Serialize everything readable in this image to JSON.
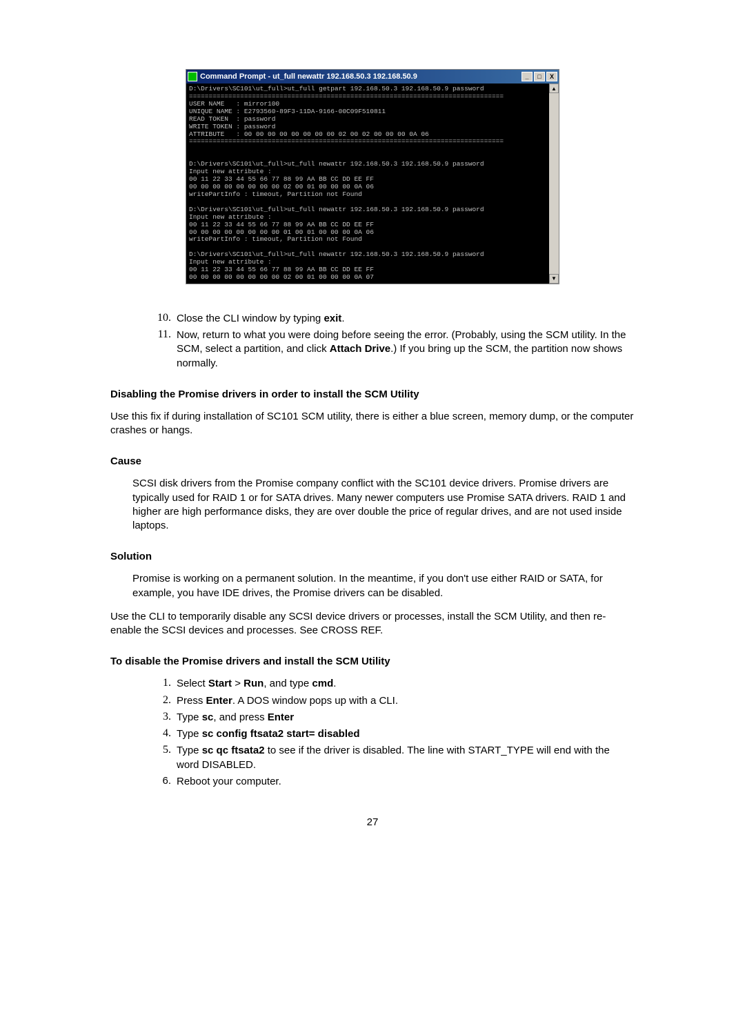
{
  "cmd": {
    "title": "Command Prompt - ut_full newattr 192.168.50.3 192.168.50.9",
    "text": "D:\\Drivers\\SC101\\ut_full>ut_full getpart 192.168.50.3 192.168.50.9 password\n================================================================================\nUSER NAME   : mirror100\nUNIQUE NAME : E2793560-89F3-11DA-9166-00C09F510811\nREAD TOKEN  : password\nWRITE TOKEN : password\nATTRIBUTE   : 00 00 00 00 00 00 00 00 02 00 02 00 00 00 0A 06\n================================================================================\n\n\nD:\\Drivers\\SC101\\ut_full>ut_full newattr 192.168.50.3 192.168.50.9 password\nInput new attribute :\n00 11 22 33 44 55 66 77 88 99 AA BB CC DD EE FF\n00 00 00 00 00 00 00 00 02 00 01 00 00 00 0A 06\nwritePartInfo : timeout, Partition not Found\n\nD:\\Drivers\\SC101\\ut_full>ut_full newattr 192.168.50.3 192.168.50.9 password\nInput new attribute :\n00 11 22 33 44 55 66 77 88 99 AA BB CC DD EE FF\n00 00 00 00 00 00 00 00 01 00 01 00 00 00 0A 06\nwritePartInfo : timeout, Partition not Found\n\nD:\\Drivers\\SC101\\ut_full>ut_full newattr 192.168.50.3 192.168.50.9 password\nInput new attribute :\n00 11 22 33 44 55 66 77 88 99 AA BB CC DD EE FF\n00 00 00 00 00 00 00 00 02 00 01 00 00 00 0A 07"
  },
  "glyphs": {
    "min": "_",
    "max": "□",
    "close": "X",
    "up": "▲",
    "down": "▼"
  },
  "step10": {
    "num": "10.",
    "t1": "Close the CLI window by typing ",
    "b1": "exit",
    "t2": "."
  },
  "step11": {
    "num": "11.",
    "t1": "Now, return to what you were doing before seeing the error. (Probably, using the SCM utility. In the SCM, select a partition, and click ",
    "b1": "Attach Drive",
    "t2": ".) If you bring up the SCM, the partition now shows normally."
  },
  "h1": "Disabling the Promise drivers in order to install the SCM Utility",
  "p1": "Use this fix if during installation of SC101 SCM utility, there is either a blue screen, memory dump, or the computer crashes or hangs.",
  "hCause": "Cause",
  "pCause": "SCSI disk drivers from the Promise company conflict with the SC101 device drivers. Promise drivers are typically used for RAID 1 or for SATA drives. Many newer computers use Promise SATA drivers. RAID 1 and higher are high performance disks, they are over double the price of regular drives, and are not used inside laptops.",
  "hSol": "Solution",
  "pSol": "Promise is working on a permanent solution. In the meantime, if you don't use either RAID or SATA, for example, you have IDE drives, the Promise drivers can be disabled.",
  "pCli": "Use the CLI to temporarily disable any SCSI device drivers or processes, install the SCM Utility, and then re-enable the SCSI devices and processes. See CROSS REF.",
  "h2": "To disable the Promise drivers and install the SCM Utility",
  "s1": {
    "num": "1.",
    "t1": "Select ",
    "b1": "Start",
    "sep": " > ",
    "b2": "Run",
    "t2": ", and type ",
    "b3": "cmd",
    "t3": "."
  },
  "s2": {
    "num": "2.",
    "t1": "Press ",
    "b1": "Enter",
    "t2": ". A DOS window pops up with a CLI."
  },
  "s3": {
    "num": "3.",
    "t1": "Type ",
    "b1": "sc",
    "t2": ", and press ",
    "b2": "Enter"
  },
  "s4": {
    "num": "4.",
    "t1": "Type ",
    "b1": "sc config ftsata2 start= disabled"
  },
  "s5": {
    "num": "5.",
    "t1": "Type ",
    "b1": "sc qc ftsata2",
    "t2": " to see if the driver is disabled. The line with START_TYPE will end with the word DISABLED."
  },
  "s6": {
    "num": "6.",
    "text": "Reboot your computer."
  },
  "pageNum": "27"
}
